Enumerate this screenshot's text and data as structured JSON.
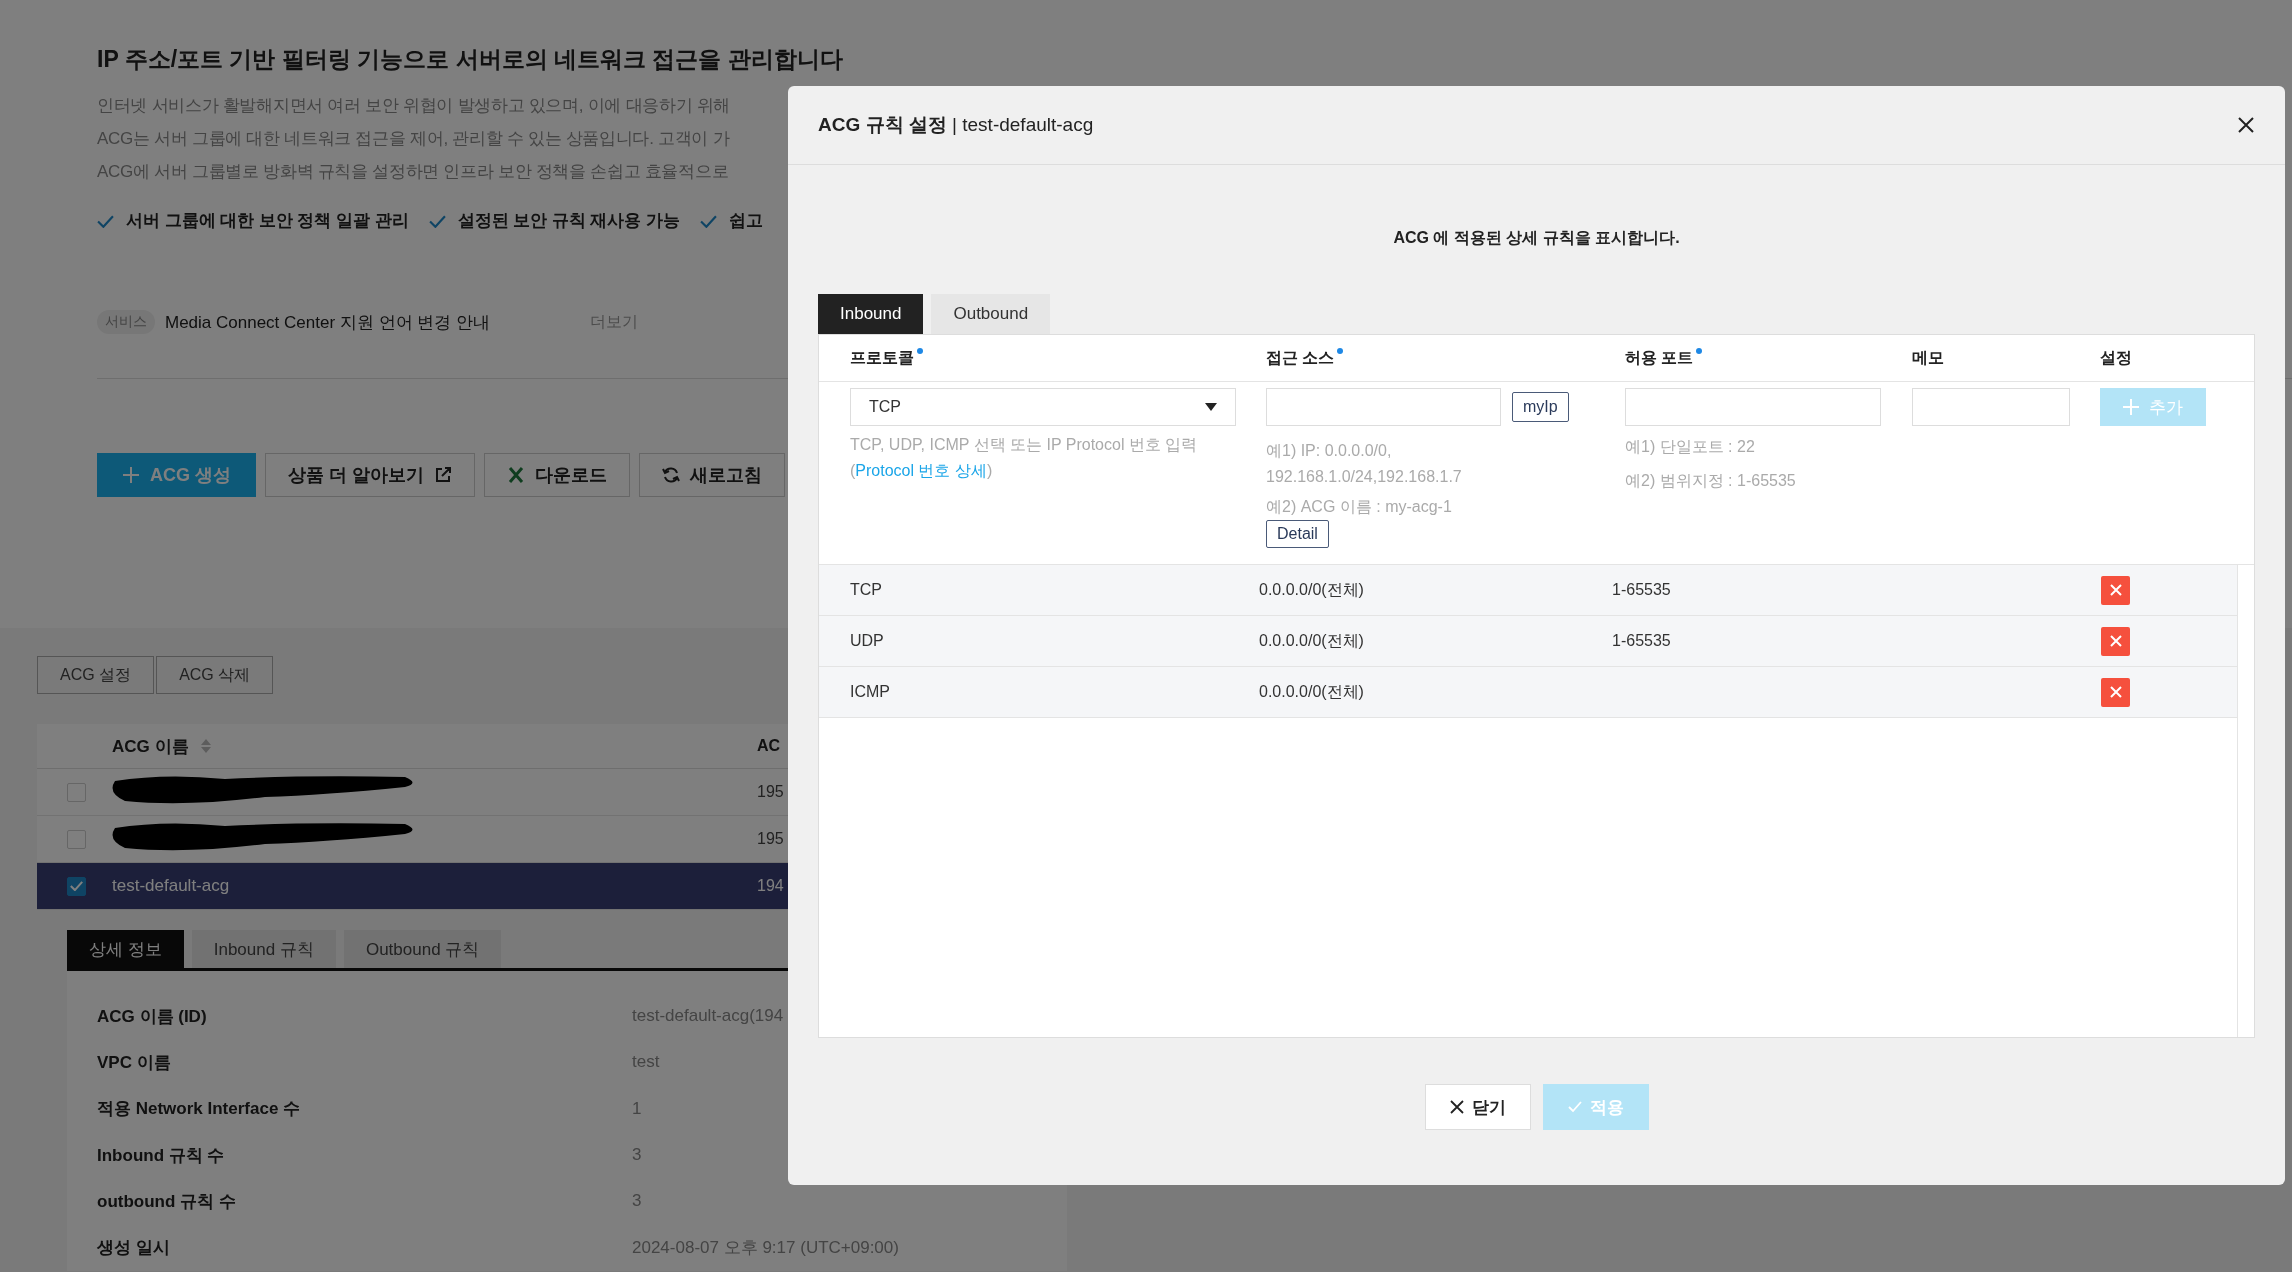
{
  "page": {
    "heading": "IP 주소/포트 기반 필터링 기능으로 서버로의 네트워크 접근을 관리합니다",
    "description_lines": [
      "인터넷 서비스가 활발해지면서 여러 보안 위협이 발생하고 있으며, 이에 대응하기 위해",
      "ACG는 서버 그룹에 대한 네트워크 접근을 제어, 관리할 수 있는 상품입니다. 고객이 가",
      "ACG에 서버 그룹별로 방화벽 규칙을 설정하면 인프라 보안 정책을 손쉽고 효율적으로"
    ],
    "features": [
      "서버 그룹에 대한 보안 정책 일괄 관리",
      "설정된 보안 규칙 재사용 가능",
      "쉽고"
    ],
    "notice": {
      "tag": "서비스",
      "text": "Media Connect Center 지원 언어 변경 안내",
      "more": "더보기"
    },
    "actions": [
      {
        "label": "ACG 생성",
        "kind": "create"
      },
      {
        "label": "상품 더 알아보기",
        "kind": "external"
      },
      {
        "label": "다운로드",
        "kind": "excel"
      },
      {
        "label": "새로고침",
        "kind": "refresh"
      }
    ]
  },
  "acg_buttons": [
    "ACG 설정",
    "ACG 삭제"
  ],
  "acg_table": {
    "columns": [
      "ACG 이름",
      "AC"
    ],
    "rows": [
      {
        "kind": "redacted",
        "checked": false,
        "selected": false,
        "column_2": "195"
      },
      {
        "kind": "redacted",
        "checked": false,
        "selected": false,
        "column_2": "195"
      },
      {
        "kind": "plain",
        "name": "test-default-acg",
        "checked": true,
        "selected": true,
        "column_2": "194"
      }
    ]
  },
  "detail_tabs": [
    {
      "label": "상세 정보",
      "selected": true
    },
    {
      "label": "Inbound 규칙",
      "selected": false
    },
    {
      "label": "Outbound 규칙",
      "selected": false
    }
  ],
  "details": [
    {
      "label": "ACG 이름 (ID)",
      "value": "test-default-acg(194"
    },
    {
      "label": "VPC 이름",
      "value": "test"
    },
    {
      "label": "적용 Network Interface 수",
      "value": "1"
    },
    {
      "label": "Inbound 규칙 수",
      "value": "3"
    },
    {
      "label": "outbound 규칙 수",
      "value": "3"
    },
    {
      "label": "생성 일시",
      "value": "2024-08-07 오후 9:17 (UTC+09:00)"
    }
  ],
  "modal": {
    "title": "ACG 규칙 설정",
    "subtitle": "| test-default-acg",
    "message": "ACG 에 적용된 상세 규칙을 표시합니다.",
    "tabs": [
      {
        "label": "Inbound",
        "selected": true
      },
      {
        "label": "Outbound",
        "selected": false
      }
    ],
    "columns": [
      {
        "label": "프로토콜",
        "required": true
      },
      {
        "label": "접근 소스",
        "required": true
      },
      {
        "label": "허용 포트",
        "required": true
      },
      {
        "label": "메모",
        "required": false
      },
      {
        "label": "설정",
        "required": false
      }
    ],
    "form": {
      "protocol": "TCP",
      "protocol_hint": {
        "text": "TCP, UDP, ICMP 선택 또는 IP Protocol 번호 입력",
        "open": "(",
        "link": "Protocol 번호 상세",
        "close": ")"
      },
      "source_button": "myIp",
      "source_hints": [
        "예1) IP: 0.0.0.0/0, 192.168.1.0/24,192.168.1.7",
        "예2) ACG 이름 : my-acg-1"
      ],
      "detail_button": "Detail",
      "port_hints": [
        "예1) 단일포트 : 22",
        "예2) 범위지정 : 1-65535"
      ],
      "add_button": {
        "label": "추가",
        "disabled": true
      }
    },
    "rules": [
      {
        "protocol": "TCP",
        "source": "0.0.0.0/0(전체)",
        "port": "1-65535"
      },
      {
        "protocol": "UDP",
        "source": "0.0.0.0/0(전체)",
        "port": "1-65535"
      },
      {
        "protocol": "ICMP",
        "source": "0.0.0.0/0(전체)"
      }
    ],
    "footer": [
      {
        "label": "닫기",
        "kind": "close",
        "disabled": false
      },
      {
        "label": "적용",
        "kind": "apply",
        "disabled": true
      }
    ]
  }
}
